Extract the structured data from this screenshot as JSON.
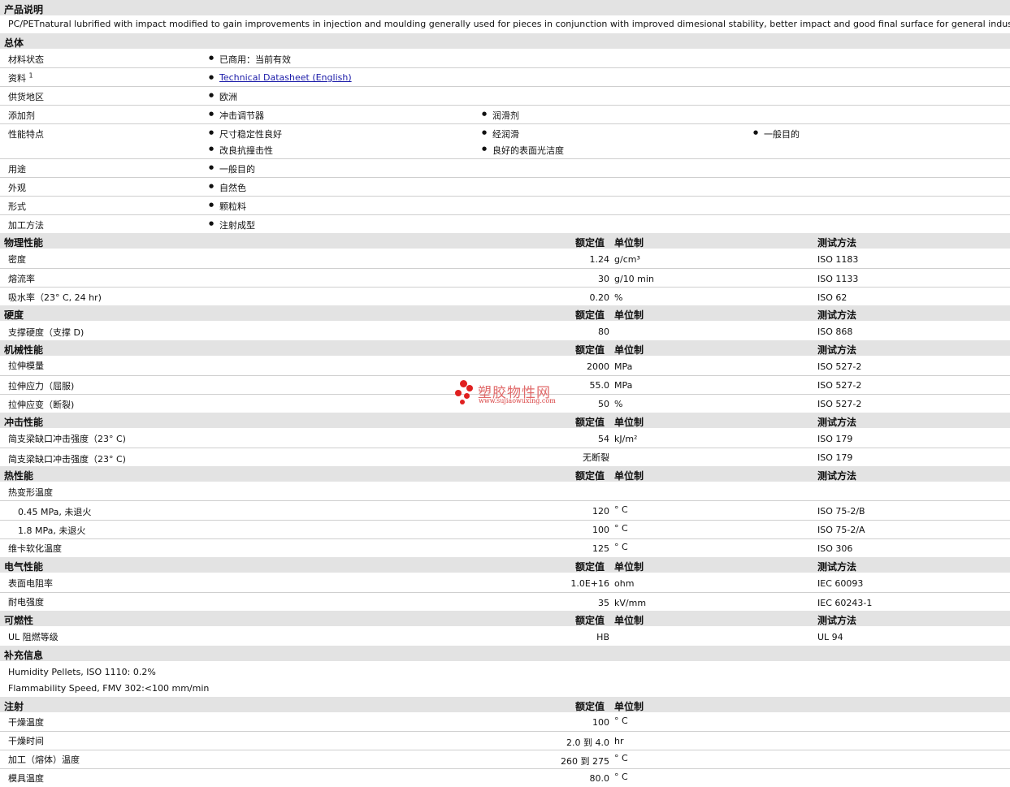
{
  "sections": {
    "desc_title": "产品说明",
    "desc_text": "PC/PETnatural lubrified with impact modified to gain improvements in injection and moulding generally used for pieces in conjunction with improved dimesional stability, better impact and good final surface for general industry.",
    "general": "总体",
    "physical": "物理性能",
    "hardness": "硬度",
    "mechanical": "机械性能",
    "impact": "冲击性能",
    "thermal": "热性能",
    "electrical": "电气性能",
    "flammability": "可燃性",
    "supplemental": "补充信息",
    "injection": "注射"
  },
  "cols": {
    "value": "额定值",
    "unit": "单位制",
    "method": "测试方法"
  },
  "general": {
    "status_label": "材料状态",
    "status_value": "已商用：当前有效",
    "doc_label": "资料",
    "doc_sup": "1",
    "doc_link": "Technical Datasheet (English)",
    "region_label": "供货地区",
    "region_value": "欧洲",
    "additive_label": "添加剂",
    "additive_1": "冲击调节器",
    "additive_2": "润滑剂",
    "features_label": "性能特点",
    "features": [
      "尺寸稳定性良好",
      "经润滑",
      "一般目的",
      "改良抗撞击性",
      "良好的表面光洁度"
    ],
    "use_label": "用途",
    "use_value": "一般目的",
    "appearance_label": "外观",
    "appearance_value": "自然色",
    "form_label": "形式",
    "form_value": "颗粒料",
    "process_label": "加工方法",
    "process_value": "注射成型"
  },
  "physical": [
    {
      "label": "密度",
      "value": "1.24",
      "unit": "g/cm³",
      "method": "ISO 1183"
    },
    {
      "label": "熔流率",
      "value": "30",
      "unit": "g/10 min",
      "method": "ISO 1133"
    },
    {
      "label": "吸水率（23° C, 24 hr)",
      "value": "0.20",
      "unit": "%",
      "method": "ISO 62"
    }
  ],
  "hardness": [
    {
      "label": "支撑硬度（支撑 D)",
      "value": "80",
      "unit": "",
      "method": "ISO 868"
    }
  ],
  "mechanical": [
    {
      "label": "拉伸模量",
      "value": "2000",
      "unit": "MPa",
      "method": "ISO 527-2"
    },
    {
      "label": "拉伸应力（屈服)",
      "value": "55.0",
      "unit": "MPa",
      "method": "ISO 527-2"
    },
    {
      "label": "拉伸应变（断裂)",
      "value": "50",
      "unit": "%",
      "method": "ISO 527-2"
    }
  ],
  "impact": [
    {
      "label": "简支梁缺口冲击强度（23° C)",
      "value": "54",
      "unit": "kJ/m²",
      "method": "ISO 179"
    },
    {
      "label": "简支梁缺口冲击强度（23° C)",
      "value": "无断裂",
      "unit": "",
      "method": "ISO 179"
    }
  ],
  "thermal": {
    "hdt_label": "热变形温度",
    "rows": [
      {
        "label": "0.45 MPa, 未退火",
        "value": "120",
        "unit": "° C",
        "method": "ISO 75-2/B"
      },
      {
        "label": "1.8 MPa, 未退火",
        "value": "100",
        "unit": "° C",
        "method": "ISO 75-2/A"
      },
      {
        "label": "维卡软化温度",
        "value": "125",
        "unit": "° C",
        "method": "ISO 306"
      }
    ]
  },
  "electrical": [
    {
      "label": "表面电阻率",
      "value": "1.0E+16",
      "unit": "ohm",
      "method": "IEC 60093"
    },
    {
      "label": "耐电强度",
      "value": "35",
      "unit": "kV/mm",
      "method": "IEC 60243-1"
    }
  ],
  "flammability": [
    {
      "label": "UL 阻燃等级",
      "value": "HB",
      "unit": "",
      "method": "UL 94"
    }
  ],
  "supplemental": [
    "Humidity Pellets, ISO 1110: 0.2%",
    "Flammability Speed, FMV 302:<100 mm/min"
  ],
  "injection": [
    {
      "label": "干燥温度",
      "value": "100",
      "unit": "° C"
    },
    {
      "label": "干燥时间",
      "value": "2.0 到  4.0",
      "unit": "hr"
    },
    {
      "label": "加工（熔体）温度",
      "value": "260 到  275",
      "unit": "° C"
    },
    {
      "label": "模具温度",
      "value": "80.0",
      "unit": "° C"
    }
  ],
  "watermark": {
    "cn": "塑胶物性网",
    "url": "www.sujiaowuxing.com",
    "color": "#e02020"
  }
}
